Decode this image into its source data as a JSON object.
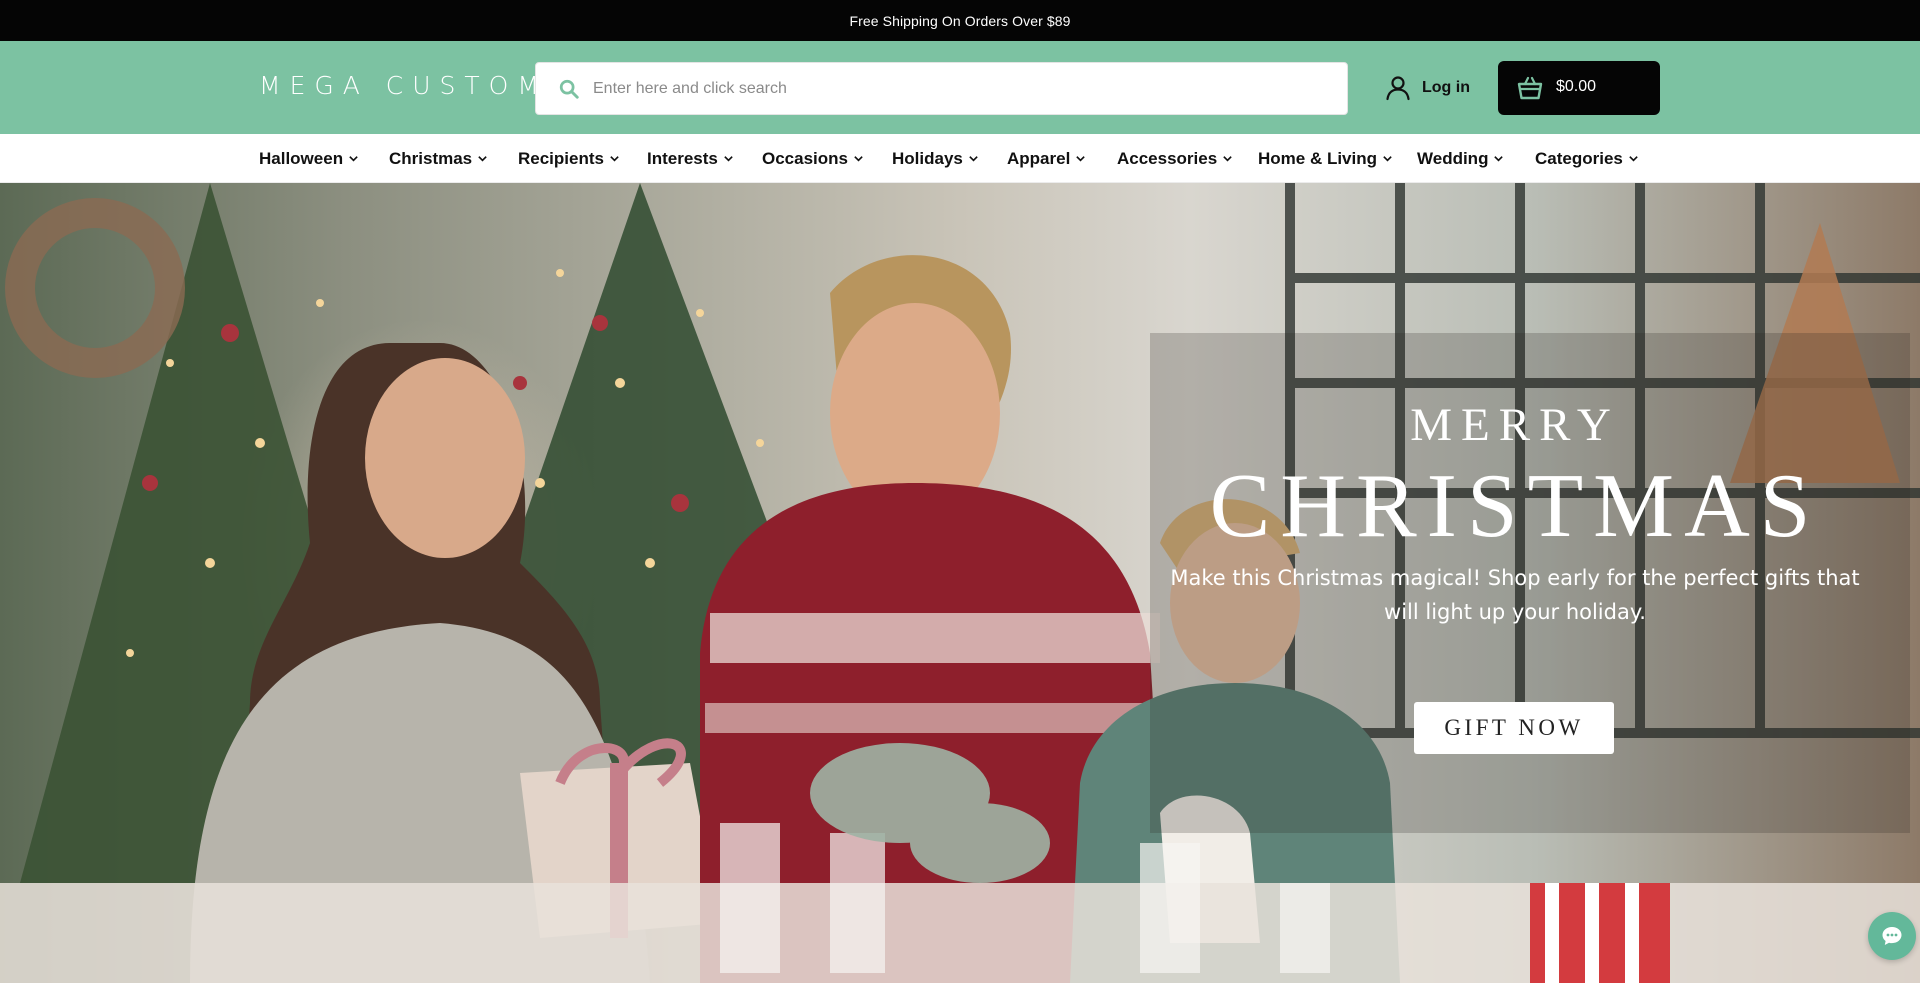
{
  "announcement": {
    "text": "Free Shipping On Orders Over $89"
  },
  "header": {
    "logo": "MEGA CUSTOM",
    "search_placeholder": "Enter here and click search",
    "search_value": "",
    "login_label": "Log in",
    "cart_amount": "$0.00",
    "background_color": "#7cc2a2"
  },
  "nav": {
    "items": [
      {
        "label": "Halloween"
      },
      {
        "label": "Christmas"
      },
      {
        "label": "Recipients"
      },
      {
        "label": "Interests"
      },
      {
        "label": "Occasions"
      },
      {
        "label": "Holidays"
      },
      {
        "label": "Apparel"
      },
      {
        "label": "Accessories"
      },
      {
        "label": "Home & Living"
      },
      {
        "label": "Wedding"
      },
      {
        "label": "Categories"
      }
    ]
  },
  "hero": {
    "kicker": "MERRY",
    "headline": "CHRISTMAS",
    "tagline": "Make this Christmas magical! Shop early for the perfect gifts that will light up your holiday.",
    "cta_label": "GIFT NOW"
  },
  "icons": {
    "search": "search-icon",
    "user": "user-icon",
    "cart": "basket-icon",
    "chevron": "chevron-down-icon",
    "chat": "chat-icon"
  }
}
